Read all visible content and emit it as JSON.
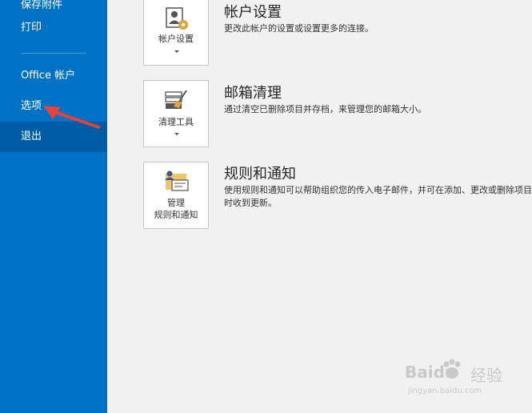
{
  "sidebar": {
    "items": [
      {
        "label": "保存附件"
      },
      {
        "label": "打印"
      },
      {
        "label": "Office 帐户"
      },
      {
        "label": "选项"
      },
      {
        "label": "退出"
      }
    ]
  },
  "sections": [
    {
      "tile_label": "帐户设置",
      "title": "帐户设置",
      "description": "更改此帐户的设置或设置更多的连接。"
    },
    {
      "tile_label": "清理工具",
      "title": "邮箱清理",
      "description": "通过清空已删除项目并存档，来管理您的邮箱大小。"
    },
    {
      "tile_label_line1": "管理",
      "tile_label_line2": "规则和通知",
      "title": "规则和通知",
      "description": "使用规则和通知可以帮助组织您的传入电子邮件，并可在添加、更改或删除项目时收到更新。"
    }
  ],
  "watermark": {
    "brand": "Baidu",
    "sub": "经验",
    "url": "jingyan.baidu.com"
  },
  "colors": {
    "sidebar": "#0072c6",
    "sidebar_selected": "#005ca5",
    "background": "#f1f1f1",
    "arrow": "#e8423b"
  }
}
